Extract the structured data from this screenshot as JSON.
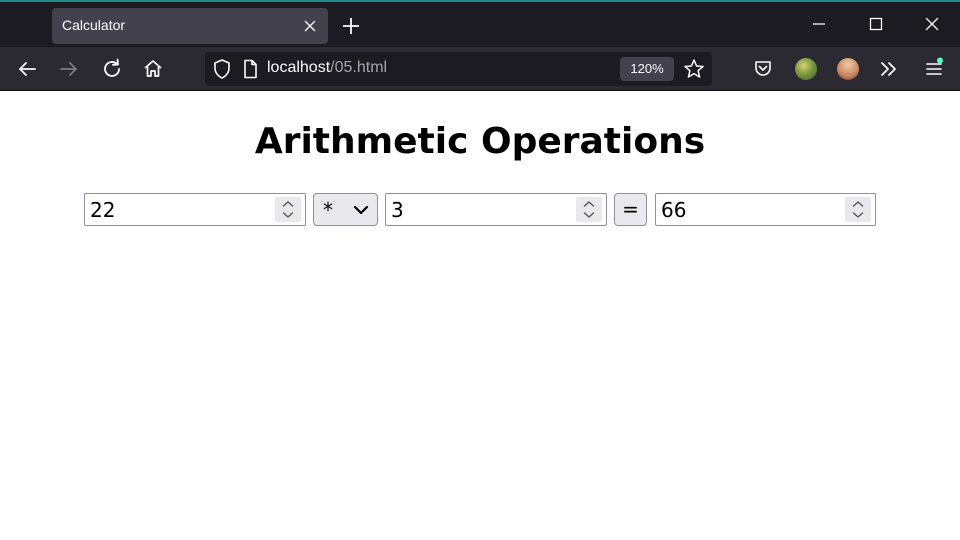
{
  "browser": {
    "tab_title": "Calculator",
    "url_host": "localhost",
    "url_path": "/05.html",
    "zoom": "120%",
    "accent": "#1f8a8a"
  },
  "page": {
    "title": "Arithmetic Operations",
    "operand1": "22",
    "operator": "*",
    "operand2": "3",
    "equals_label": "=",
    "result": "66"
  }
}
